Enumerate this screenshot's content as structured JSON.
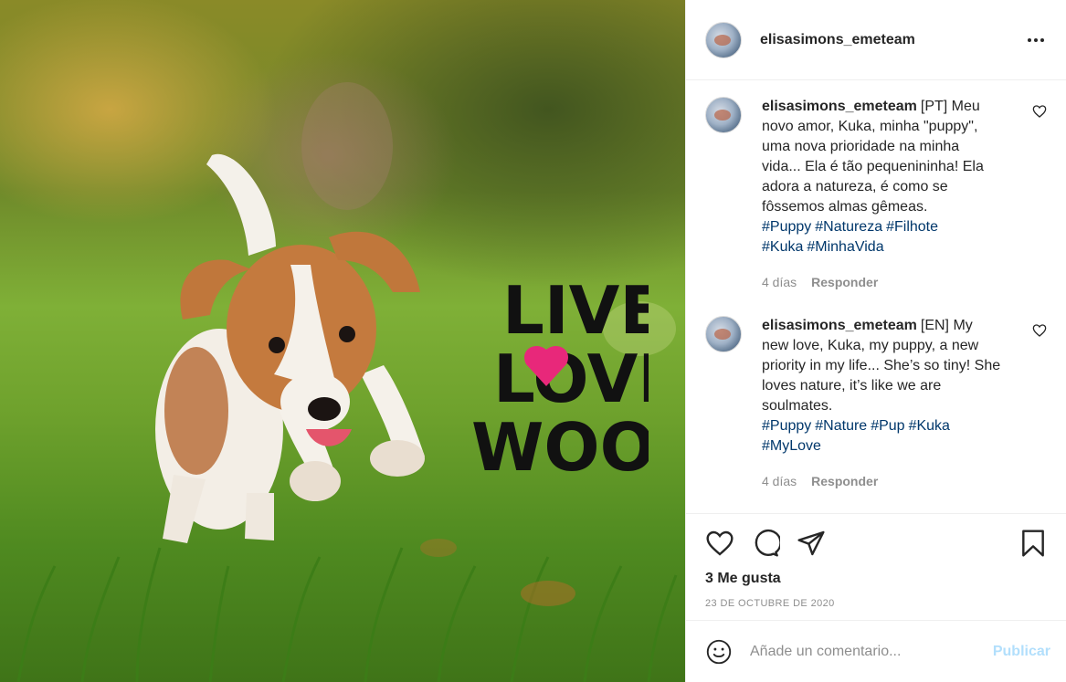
{
  "post": {
    "username": "elisasimons_emeteam",
    "sticker_lines": [
      "LIVE",
      "LOVE",
      "WOOF"
    ]
  },
  "comments": [
    {
      "username": "elisasimons_emeteam",
      "text": "[PT] Meu novo amor, Kuka, minha \"puppy\", uma nova prioridade na minha vida... Ela é tão pequenininha! Ela adora a natureza, é como se fôssemos almas gêmeas.",
      "hashtags": [
        "#Puppy",
        "#Natureza",
        "#Filhote",
        "#Kuka",
        "#MinhaVida"
      ],
      "time": "4 días",
      "reply_label": "Responder"
    },
    {
      "username": "elisasimons_emeteam",
      "text": "[EN] My new love, Kuka, my puppy, a new priority in my life... She’s so tiny! She loves nature, it’s like we are soulmates.",
      "hashtags": [
        "#Puppy",
        "#Nature",
        "#Pup",
        "#Kuka",
        "#MyLove"
      ],
      "time": "4 días",
      "reply_label": "Responder"
    }
  ],
  "actions": {
    "likes": "3 Me gusta",
    "date": "23 DE OCTUBRE DE 2020"
  },
  "comment_box": {
    "placeholder": "Añade un comentario...",
    "post_label": "Publicar"
  },
  "colors": {
    "hashtag": "#00376b",
    "muted": "#8e8e8e",
    "post_button_disabled": "#b2dffc",
    "sticker_heart": "#e8287a"
  }
}
